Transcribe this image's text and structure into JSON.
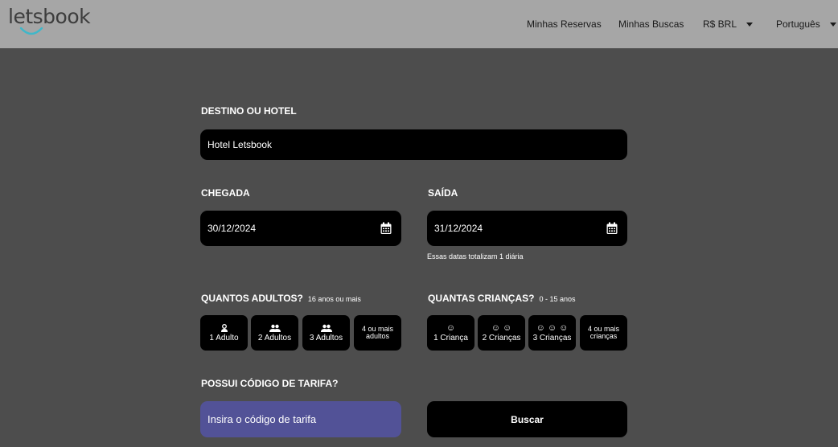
{
  "header": {
    "logo_text": "letsbook",
    "nav": {
      "reservas": "Minhas Reservas",
      "buscas": "Minhas Buscas",
      "currency": "R$ BRL",
      "language": "Português"
    }
  },
  "form": {
    "destino": {
      "label": "DESTINO OU HOTEL",
      "value": "Hotel Letsbook"
    },
    "chegada": {
      "label": "CHEGADA",
      "value": "30/12/2024"
    },
    "saida": {
      "label": "SAÍDA",
      "value": "31/12/2024"
    },
    "dates_hint": "Essas datas totalizam 1 diária",
    "adultos": {
      "label": "QUANTOS ADULTOS?",
      "sublabel": "16 anos ou mais",
      "options": [
        {
          "icon": "☺",
          "label": "1 Adulto"
        },
        {
          "icon": "☺☺",
          "label": "2 Adultos"
        },
        {
          "icon": "☺☺",
          "label": "3 Adultos"
        },
        {
          "line1": "4 ou mais",
          "line2": "adultos"
        }
      ]
    },
    "criancas": {
      "label": "QUANTAS CRIANÇAS?",
      "sublabel": "0 - 15 anos",
      "options": [
        {
          "icon": "☺",
          "label": "1 Criança"
        },
        {
          "icon": "☺ ☺",
          "label": "2 Crianças"
        },
        {
          "icon": "☺ ☺ ☺",
          "label": "3 Crianças"
        },
        {
          "line1": "4 ou mais",
          "line2": "crianças"
        }
      ]
    },
    "tarifa": {
      "label": "POSSUI CÓDIGO DE TARIFA?",
      "button": "Insira o código de tarifa"
    },
    "buscar": "Buscar"
  },
  "colors": {
    "background": "#4d4d4d",
    "header": "#a6a6a6",
    "field": "#000000",
    "tarifa_button": "#525297",
    "logo_accent": "#3fb7c9"
  }
}
